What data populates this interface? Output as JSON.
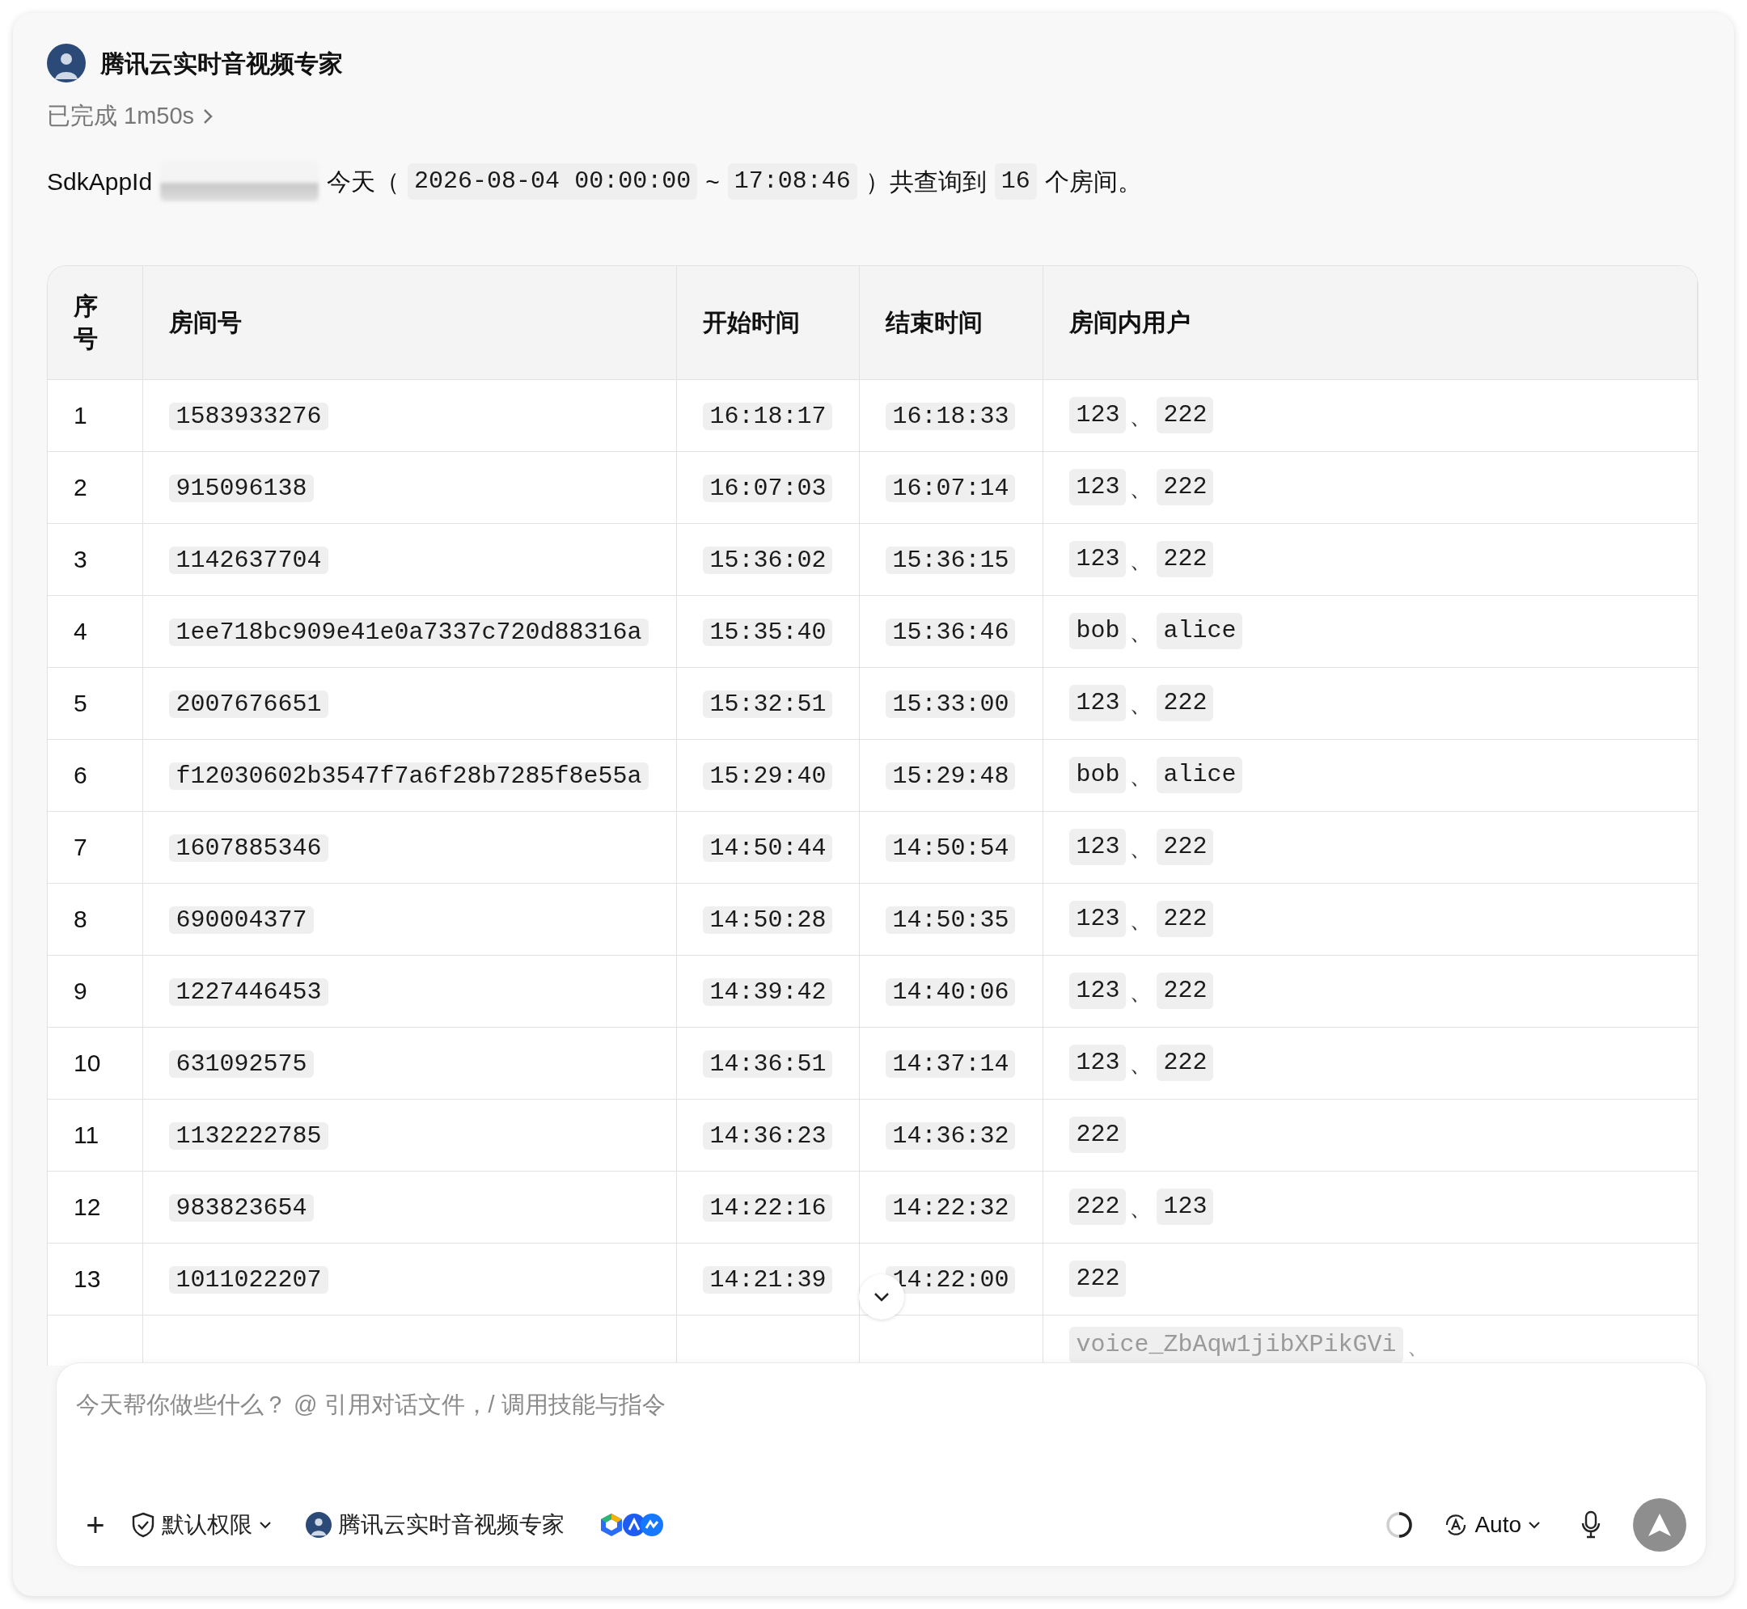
{
  "agent": {
    "name": "腾讯云实时音视频专家"
  },
  "status": {
    "text": "已完成 1m50s"
  },
  "summary": [
    {
      "kind": "text",
      "text": "SdkAppId"
    },
    {
      "kind": "redacted"
    },
    {
      "kind": "text",
      "text": "今天（"
    },
    {
      "kind": "code",
      "text": "2026-08-04 00:00:00"
    },
    {
      "kind": "text",
      "text": "~"
    },
    {
      "kind": "code",
      "text": "17:08:46"
    },
    {
      "kind": "text",
      "text": "）共查询到"
    },
    {
      "kind": "code",
      "text": "16"
    },
    {
      "kind": "text",
      "text": "个房间。"
    }
  ],
  "table": {
    "columns": [
      "序号",
      "房间号",
      "开始时间",
      "结束时间",
      "房间内用户"
    ],
    "user_separator": "、",
    "rows": [
      {
        "index": "1",
        "room": "1583933276",
        "start": "16:18:17",
        "end": "16:18:33",
        "users": [
          "123",
          "222"
        ]
      },
      {
        "index": "2",
        "room": "915096138",
        "start": "16:07:03",
        "end": "16:07:14",
        "users": [
          "123",
          "222"
        ]
      },
      {
        "index": "3",
        "room": "1142637704",
        "start": "15:36:02",
        "end": "15:36:15",
        "users": [
          "123",
          "222"
        ]
      },
      {
        "index": "4",
        "room": "1ee718bc909e41e0a7337c720d88316a",
        "start": "15:35:40",
        "end": "15:36:46",
        "users": [
          "bob",
          "alice"
        ]
      },
      {
        "index": "5",
        "room": "2007676651",
        "start": "15:32:51",
        "end": "15:33:00",
        "users": [
          "123",
          "222"
        ]
      },
      {
        "index": "6",
        "room": "f12030602b3547f7a6f28b7285f8e55a",
        "start": "15:29:40",
        "end": "15:29:48",
        "users": [
          "bob",
          "alice"
        ]
      },
      {
        "index": "7",
        "room": "1607885346",
        "start": "14:50:44",
        "end": "14:50:54",
        "users": [
          "123",
          "222"
        ]
      },
      {
        "index": "8",
        "room": "690004377",
        "start": "14:50:28",
        "end": "14:50:35",
        "users": [
          "123",
          "222"
        ]
      },
      {
        "index": "9",
        "room": "1227446453",
        "start": "14:39:42",
        "end": "14:40:06",
        "users": [
          "123",
          "222"
        ]
      },
      {
        "index": "10",
        "room": "631092575",
        "start": "14:36:51",
        "end": "14:37:14",
        "users": [
          "123",
          "222"
        ]
      },
      {
        "index": "11",
        "room": "1132222785",
        "start": "14:36:23",
        "end": "14:36:32",
        "users": [
          "222"
        ]
      },
      {
        "index": "12",
        "room": "983823654",
        "start": "14:22:16",
        "end": "14:22:32",
        "users": [
          "222",
          "123"
        ]
      },
      {
        "index": "13",
        "room": "1011022207",
        "start": "14:21:39",
        "end": "14:22:00",
        "users": [
          "222"
        ]
      }
    ],
    "partial_row": {
      "users": [
        "voice_ZbAqw1jibXPikGVi"
      ],
      "trailing_separator": true
    }
  },
  "composer": {
    "placeholder": "今天帮你做些什么？ @ 引用对话文件，/ 调用技能与指令",
    "add_label": "+",
    "permission": "默认权限",
    "agent": "腾讯云实时音视频专家",
    "model": "Auto"
  }
}
